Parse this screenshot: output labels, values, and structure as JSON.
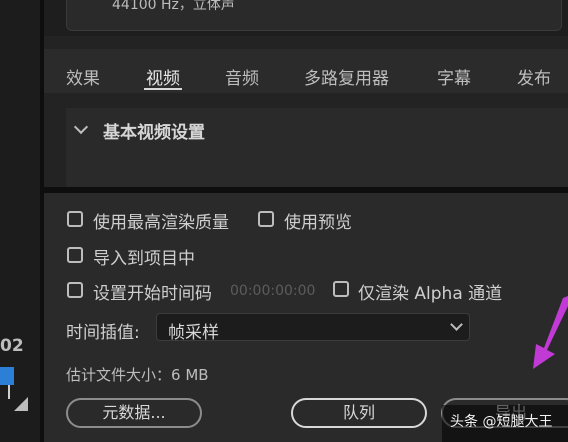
{
  "top": {
    "audio_info": "44100 Hz，立体声"
  },
  "tabs": [
    {
      "label": "效果"
    },
    {
      "label": "视频"
    },
    {
      "label": "音频"
    },
    {
      "label": "多路复用器"
    },
    {
      "label": "字幕"
    },
    {
      "label": "发布"
    }
  ],
  "active_tab": "视频",
  "section": {
    "title": "基本视频设置"
  },
  "options": {
    "max_render_quality": "使用最高渲染质量",
    "use_previews": "使用预览",
    "import_to_project": "导入到项目中",
    "set_start_timecode": "设置开始时间码",
    "timecode_value": "00:00:00:00",
    "render_alpha_only": "仅渲染 Alpha 通道"
  },
  "interpolation": {
    "label": "时间插值:",
    "value": "帧采样"
  },
  "filesize": {
    "label": "估计文件大小：",
    "value": "6 MB"
  },
  "buttons": {
    "metadata": "元数据...",
    "queue": "队列",
    "export": "导出"
  },
  "left": {
    "number": "02"
  },
  "watermark": "头条 @短腿大王",
  "colors": {
    "background": "#232323",
    "panel": "#2a2a2a",
    "accent_arrow": "#c23ad6",
    "marker": "#2b7fd6"
  }
}
